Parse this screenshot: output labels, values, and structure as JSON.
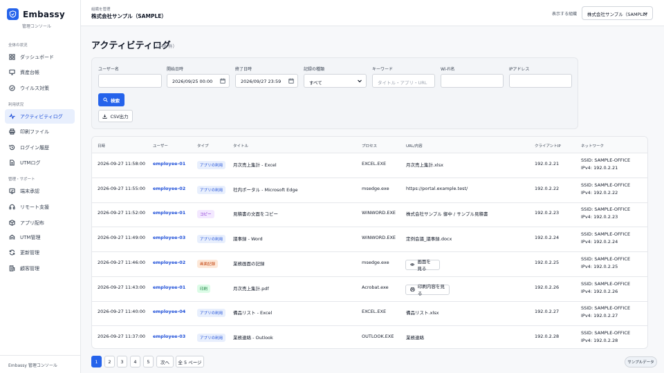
{
  "brand": {
    "name": "Embassy",
    "subtitle": "管理コンソール"
  },
  "sidebar": {
    "sections": [
      {
        "title": "全体の状況",
        "items": [
          {
            "label": "ダッシュボード",
            "icon": "dashboard-icon"
          },
          {
            "label": "資産台帳",
            "icon": "monitor-icon"
          },
          {
            "label": "ウイルス対策",
            "icon": "shield-check-icon"
          }
        ]
      },
      {
        "title": "利用状況",
        "items": [
          {
            "label": "アクティビティログ",
            "icon": "activity-icon",
            "active": true
          },
          {
            "label": "印刷ファイル",
            "icon": "printer-icon"
          },
          {
            "label": "ログイン履歴",
            "icon": "history-icon"
          },
          {
            "label": "UTMログ",
            "icon": "document-icon"
          }
        ]
      },
      {
        "title": "管理・サポート",
        "items": [
          {
            "label": "端末承認",
            "icon": "approve-icon"
          },
          {
            "label": "リモート支援",
            "icon": "headset-icon"
          },
          {
            "label": "アプリ配布",
            "icon": "package-icon"
          },
          {
            "label": "UTM管理",
            "icon": "utm-icon"
          },
          {
            "label": "更新管理",
            "icon": "refresh-icon"
          },
          {
            "label": "顧客管理",
            "icon": "building-icon"
          }
        ]
      }
    ],
    "footer": "Embassy 管理コンソール"
  },
  "header": {
    "org_caption": "組織を管理",
    "org_name": "株式会社サンプル（SAMPLE）",
    "org_select_label": "表示する組織",
    "org_select_value": "株式会社サンプル（SAMPLE）"
  },
  "page": {
    "title": "アクティビティログ",
    "count": "（248 件）"
  },
  "filters": {
    "user_label": "ユーザー名",
    "user_value": "",
    "start_label": "開始日時",
    "start_value": "2026/09/25 00:00",
    "end_label": "終了日時",
    "end_value": "2026/09/27 23:59",
    "type_label": "記録の種類",
    "type_value": "すべて",
    "keyword_label": "キーワード",
    "keyword_placeholder": "タイトル・アプリ・URL",
    "wifi_label": "Wi-Fi名",
    "ip_label": "IPアドレス",
    "search_button": "検索",
    "csv_button": "CSV出力"
  },
  "table": {
    "columns": [
      "日時",
      "ユーザー",
      "タイプ",
      "タイトル",
      "プロセス",
      "URL/内容",
      "クライアントIP",
      "ネットワーク"
    ],
    "rows": [
      {
        "time": "2026-09-27 11:58:00",
        "user": "employee-01",
        "type": "アプリの利用",
        "type_kind": "app",
        "title": "月次売上集計 - Excel",
        "process": "EXCEL.EXE",
        "url": "月次売上集計.xlsx",
        "ip": "192.0.2.21",
        "ssid": "SSID: SAMPLE-OFFICE",
        "ipv4": "IPv4: 192.0.2.21"
      },
      {
        "time": "2026-09-27 11:55:00",
        "user": "employee-02",
        "type": "アプリの利用",
        "type_kind": "app",
        "title": "社内ポータル - Microsoft Edge",
        "process": "msedge.exe",
        "url": "https://portal.example.test/",
        "ip": "192.0.2.22",
        "ssid": "SSID: SAMPLE-OFFICE",
        "ipv4": "IPv4: 192.0.2.22"
      },
      {
        "time": "2026-09-27 11:52:00",
        "user": "employee-01",
        "type": "コピー",
        "type_kind": "copy",
        "title": "見積書の文面をコピー",
        "process": "WINWORD.EXE",
        "url": "株式会社サンプル 御中 / サンプル見積書",
        "ip": "192.0.2.23",
        "ssid": "SSID: SAMPLE-OFFICE",
        "ipv4": "IPv4: 192.0.2.23"
      },
      {
        "time": "2026-09-27 11:49:00",
        "user": "employee-03",
        "type": "アプリの利用",
        "type_kind": "app",
        "title": "議事録 - Word",
        "process": "WINWORD.EXE",
        "url": "定例会議_議事録.docx",
        "ip": "192.0.2.24",
        "ssid": "SSID: SAMPLE-OFFICE",
        "ipv4": "IPv4: 192.0.2.24"
      },
      {
        "time": "2026-09-27 11:46:00",
        "user": "employee-02",
        "type": "画面記録",
        "type_kind": "screen",
        "title": "業務画面の記録",
        "process": "msedge.exe",
        "url_button": "画面を見る",
        "url_icon": "eye-icon",
        "ip": "192.0.2.25",
        "ssid": "SSID: SAMPLE-OFFICE",
        "ipv4": "IPv4: 192.0.2.25"
      },
      {
        "time": "2026-09-27 11:43:00",
        "user": "employee-01",
        "type": "印刷",
        "type_kind": "print",
        "title": "月次売上集計.pdf",
        "process": "Acrobat.exe",
        "url_button": "印刷内容を見る",
        "url_icon": "printer-icon",
        "ip": "192.0.2.26",
        "ssid": "SSID: SAMPLE-OFFICE",
        "ipv4": "IPv4: 192.0.2.26"
      },
      {
        "time": "2026-09-27 11:40:00",
        "user": "employee-04",
        "type": "アプリの利用",
        "type_kind": "app",
        "title": "備品リスト - Excel",
        "process": "EXCEL.EXE",
        "url": "備品リスト.xlsx",
        "ip": "192.0.2.27",
        "ssid": "SSID: SAMPLE-OFFICE",
        "ipv4": "IPv4: 192.0.2.27"
      },
      {
        "time": "2026-09-27 11:37:00",
        "user": "employee-03",
        "type": "アプリの利用",
        "type_kind": "app",
        "title": "業務連絡 - Outlook",
        "process": "OUTLOOK.EXE",
        "url": "業務連絡",
        "ip": "192.0.2.28",
        "ssid": "SSID: SAMPLE-OFFICE",
        "ipv4": "IPv4: 192.0.2.28"
      }
    ]
  },
  "pagination": {
    "pages": [
      "1",
      "2",
      "3",
      "4",
      "5"
    ],
    "current": "1",
    "next": "次へ",
    "total": "全 5 ページ"
  },
  "sample_chip": "サンプルデータ",
  "colors": {
    "accent": "#2563eb",
    "active_bg": "#e8effd"
  }
}
